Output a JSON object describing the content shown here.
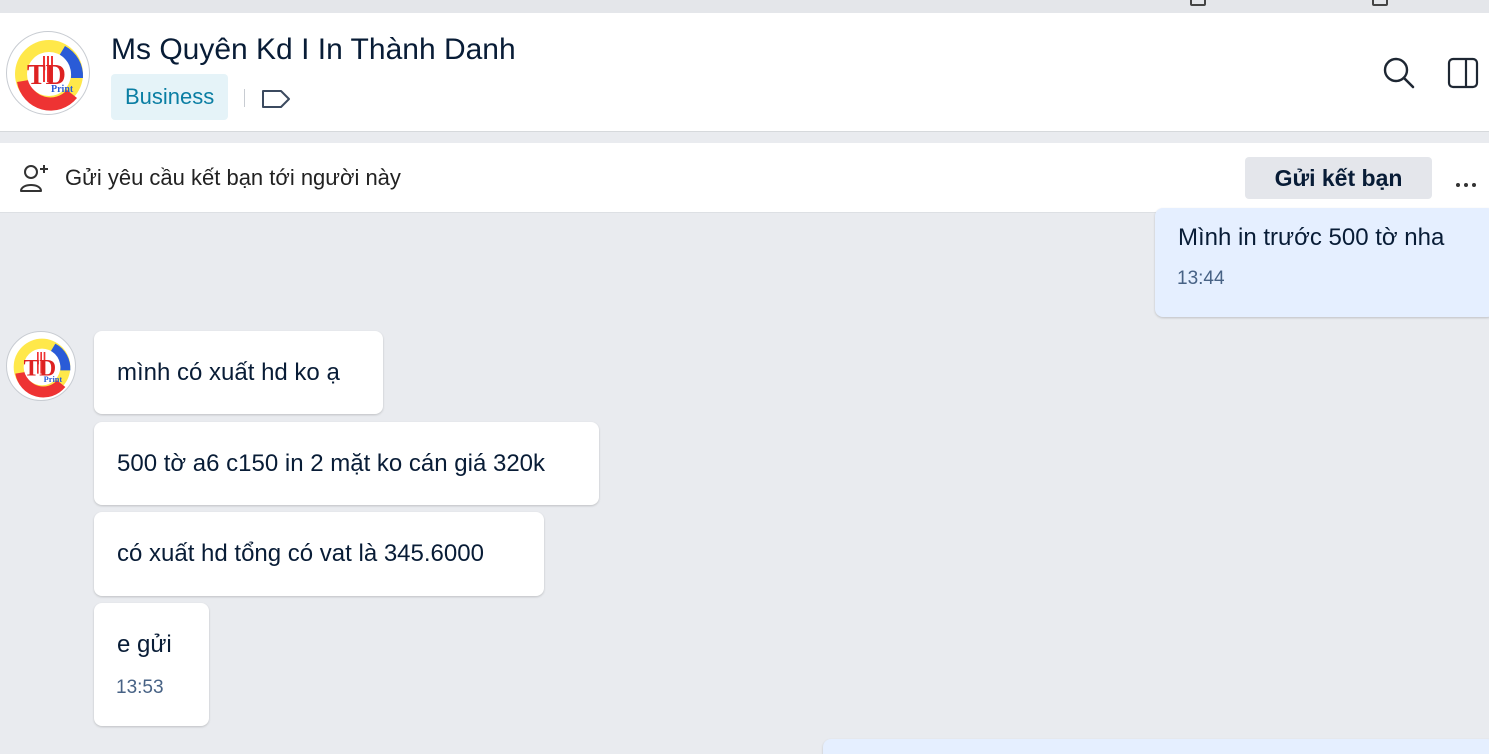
{
  "header": {
    "contact_name": "Ms Quyên Kd I In Thành Danh",
    "badge_label": "Business",
    "logo_text": "TD",
    "logo_subtext": "Print"
  },
  "friend_bar": {
    "prompt": "Gửi yêu cầu kết bạn tới người này",
    "button_label": "Gửi kết bạn"
  },
  "messages": [
    {
      "sender": "me",
      "text": "Mình in trước 500 tờ nha",
      "time": "13:44"
    },
    {
      "sender": "contact",
      "text": "mình có xuất hd ko ạ"
    },
    {
      "sender": "contact",
      "text": "500 tờ a6 c150 in 2 mặt ko cán giá 320k"
    },
    {
      "sender": "contact",
      "text": "có xuất hd tổng có vat là 345.6000"
    },
    {
      "sender": "contact",
      "text": "e gửi",
      "time": "13:53"
    }
  ],
  "colors": {
    "chat_background": "#e9ebef",
    "my_bubble": "#e5efff",
    "contact_bubble": "#ffffff",
    "badge_background": "#e5f3f8",
    "badge_text": "#0a7ea3"
  },
  "icons": [
    "tag-icon",
    "search-icon",
    "side-panel-icon",
    "add-friend-icon",
    "more-options-icon"
  ]
}
